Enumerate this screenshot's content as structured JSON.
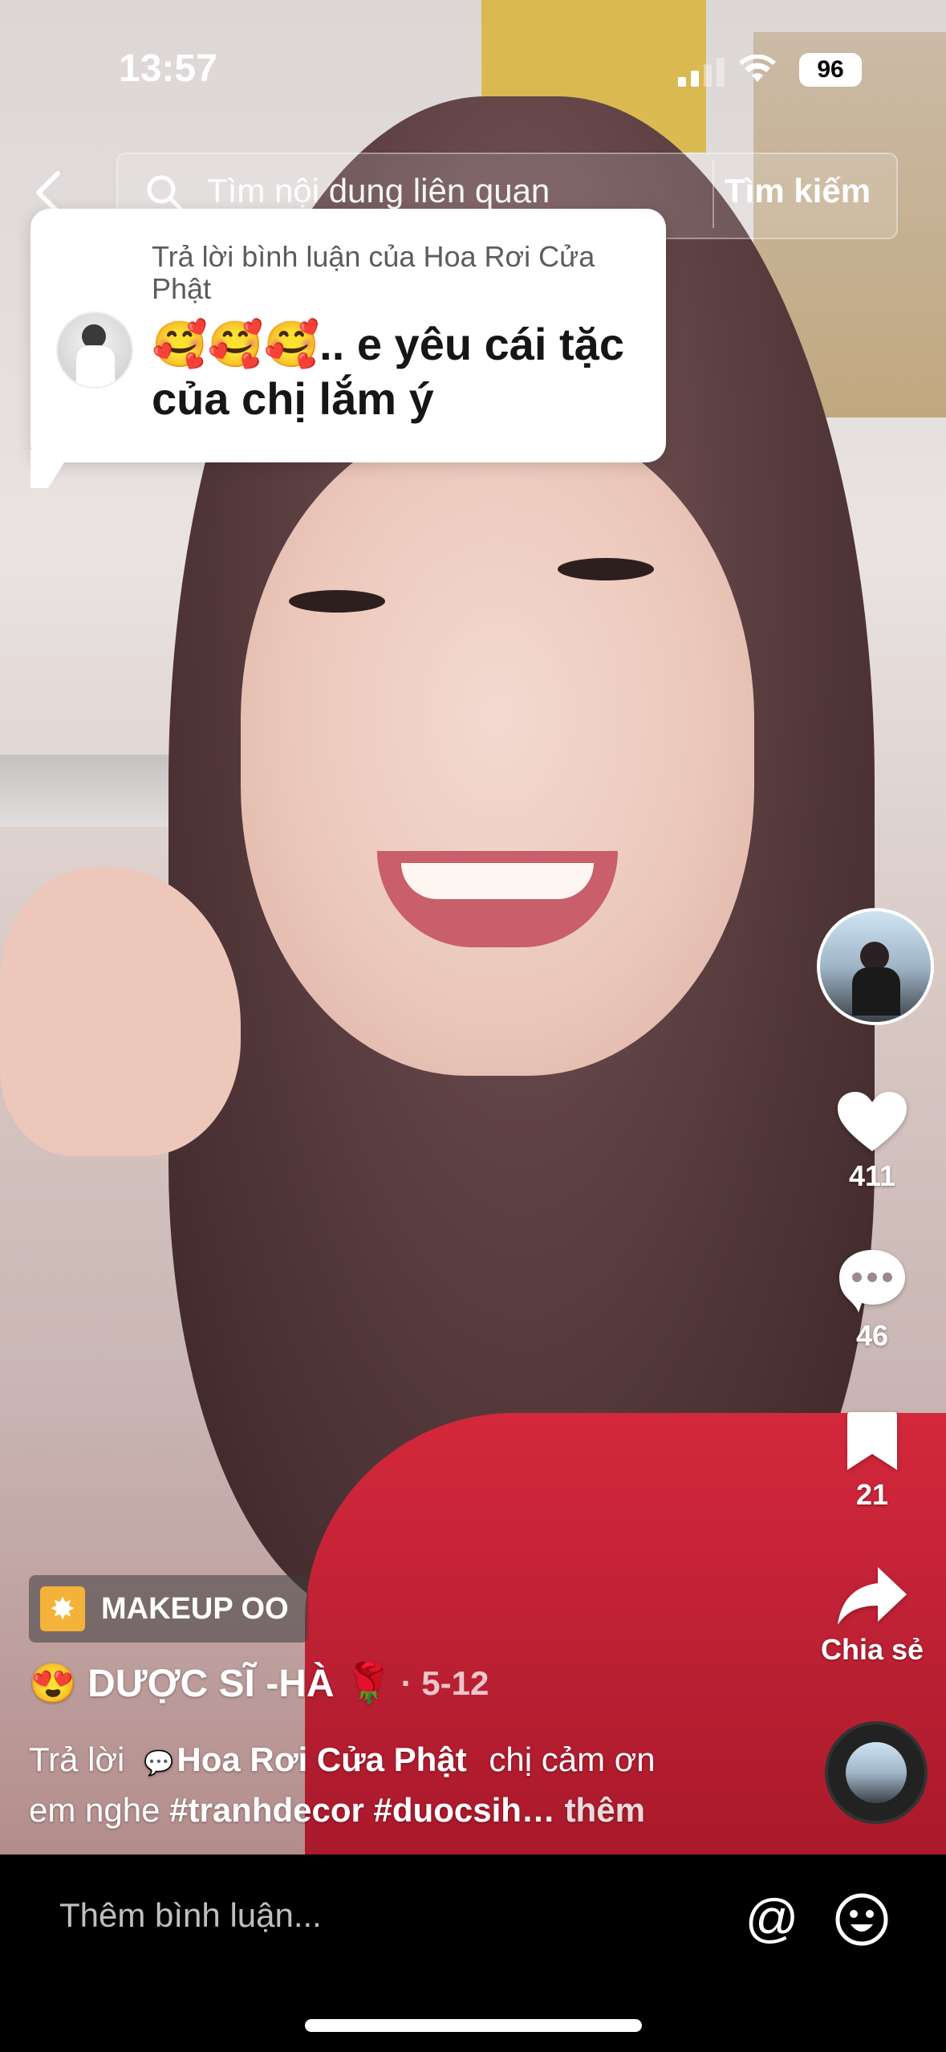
{
  "status_bar": {
    "time": "13:57",
    "battery": "96"
  },
  "search": {
    "placeholder": "Tìm nội dung liên quan",
    "button": "Tìm kiếm"
  },
  "reply_bubble": {
    "header": "Trả lời bình luận của Hoa Rơi Cửa Phật",
    "text": "🥰🥰🥰.. e yêu cái tặc của chị lắm ý"
  },
  "actions": {
    "likes": "411",
    "comments": "46",
    "saves": "21",
    "share_label": "Chia sẻ"
  },
  "effect": {
    "label": "MAKEUP OO"
  },
  "post": {
    "author": "😍 DƯỢC SĨ -HÀ 🌹",
    "date": "· 5-12",
    "reply_prefix": "Trả lời",
    "reply_to": "Hoa Rơi Cửa Phật",
    "caption_1": "chị cảm ơn",
    "caption_2": "em nghe",
    "hashtags": "#tranhdecor #duocsih…",
    "more": "thêm"
  },
  "comment_input": {
    "placeholder": "Thêm bình luận..."
  },
  "icons": {
    "back": "chevron-left-icon",
    "search": "search-icon",
    "like": "heart-icon",
    "comment": "comment-dots-icon",
    "save": "bookmark-icon",
    "share": "share-arrow-icon",
    "mention": "at-icon",
    "emoji": "emoji-icon"
  }
}
